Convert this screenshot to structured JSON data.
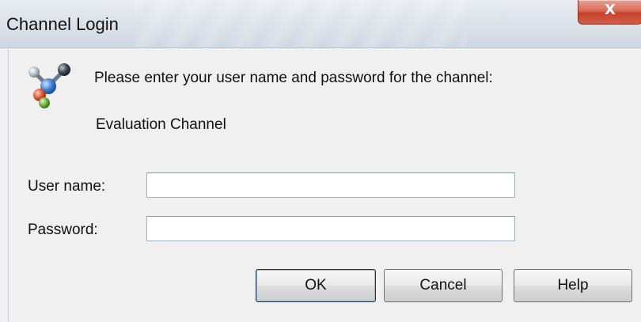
{
  "window": {
    "title": "Channel Login",
    "close_glyph": "X"
  },
  "icons": {
    "app_icon": "channel-network-icon",
    "close_icon": "close-icon"
  },
  "dialog": {
    "prompt": "Please enter your user name and password for the channel:",
    "channel_name": "Evaluation Channel"
  },
  "form": {
    "username_label": "User name:",
    "username_value": "",
    "password_label": "Password:",
    "password_value": ""
  },
  "buttons": {
    "ok_label": "OK",
    "cancel_label": "Cancel",
    "help_label": "Help"
  },
  "colors": {
    "close_button": "#c7412b",
    "dialog_background": "#f0f0f0"
  }
}
